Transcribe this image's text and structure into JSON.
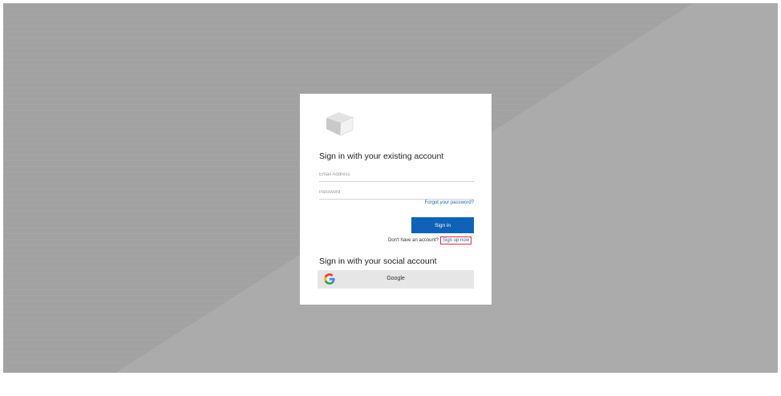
{
  "card": {
    "existing_heading": "Sign in with your existing account",
    "email_placeholder": "Email Address",
    "password_placeholder": "Password",
    "forgot_link": "Forgot your password?",
    "signin_button": "Sign in",
    "no_account_text": "Don't have an account?",
    "signup_link": "Sign up now",
    "social_heading": "Sign in with your social account",
    "google_button": "Google"
  },
  "icons": {
    "logo": "cube-logo-icon",
    "google": "google-icon"
  },
  "colors": {
    "backdrop": "#a2a2a2",
    "primary_button": "#0f62b8",
    "link": "#1f64b0",
    "highlight_border": "#e03030",
    "social_button": "#e6e6e6"
  }
}
